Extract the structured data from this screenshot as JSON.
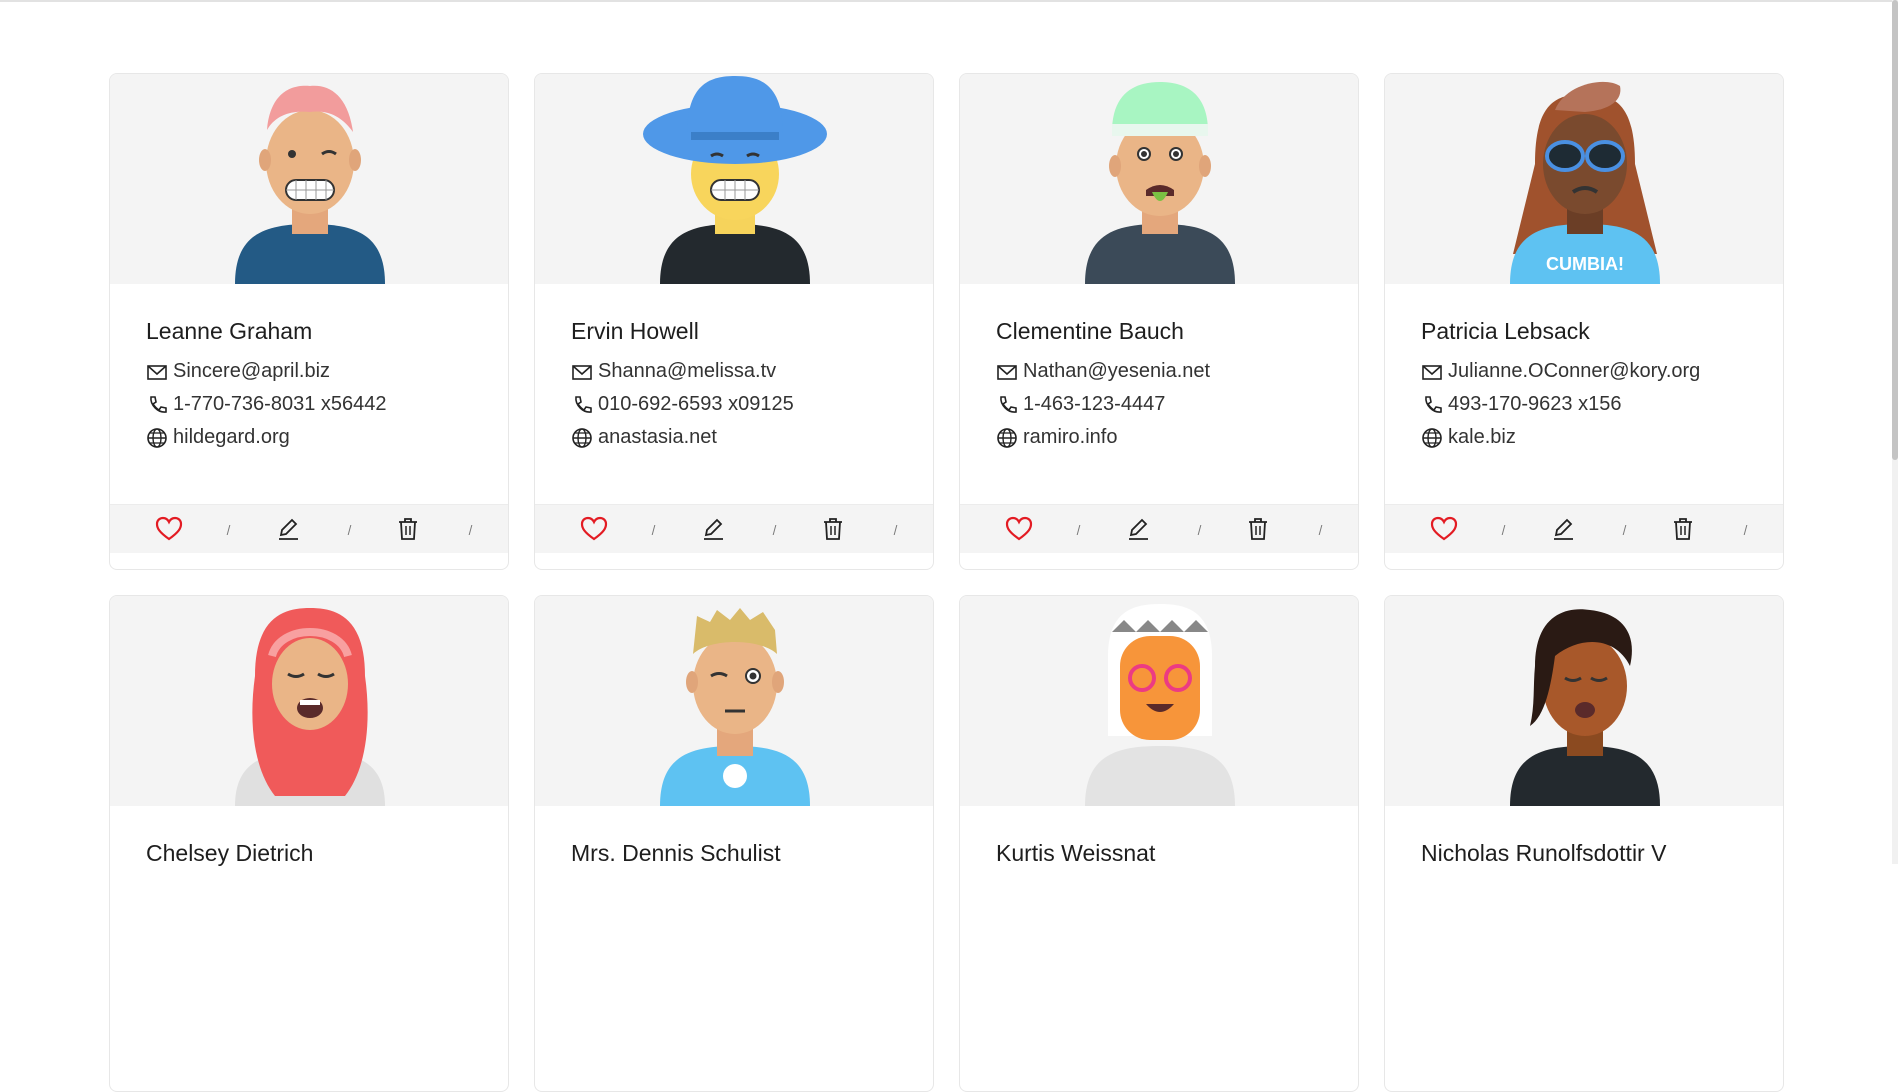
{
  "users": [
    {
      "name": "Leanne Graham",
      "email": "Sincere@april.biz",
      "phone": "1-770-736-8031 x56442",
      "website": "hildegard.org"
    },
    {
      "name": "Ervin Howell",
      "email": "Shanna@melissa.tv",
      "phone": "010-692-6593 x09125",
      "website": "anastasia.net"
    },
    {
      "name": "Clementine Bauch",
      "email": "Nathan@yesenia.net",
      "phone": "1-463-123-4447",
      "website": "ramiro.info"
    },
    {
      "name": "Patricia Lebsack",
      "email": "Julianne.OConner@kory.org",
      "phone": "493-170-9623 x156",
      "website": "kale.biz"
    },
    {
      "name": "Chelsey Dietrich",
      "email": "",
      "phone": "",
      "website": ""
    },
    {
      "name": "Mrs. Dennis Schulist",
      "email": "",
      "phone": "",
      "website": ""
    },
    {
      "name": "Kurtis Weissnat",
      "email": "",
      "phone": "",
      "website": ""
    },
    {
      "name": "Nicholas Runolfsdottir V",
      "email": "",
      "phone": "",
      "website": ""
    }
  ],
  "icons": {
    "email": "mail-icon",
    "phone": "phone-icon",
    "website": "globe-icon",
    "like": "heart-icon",
    "edit": "pencil-icon",
    "delete": "trash-icon"
  },
  "colors": {
    "like": "#e31b23",
    "panel": "#f4f4f4",
    "text": "#222222"
  }
}
